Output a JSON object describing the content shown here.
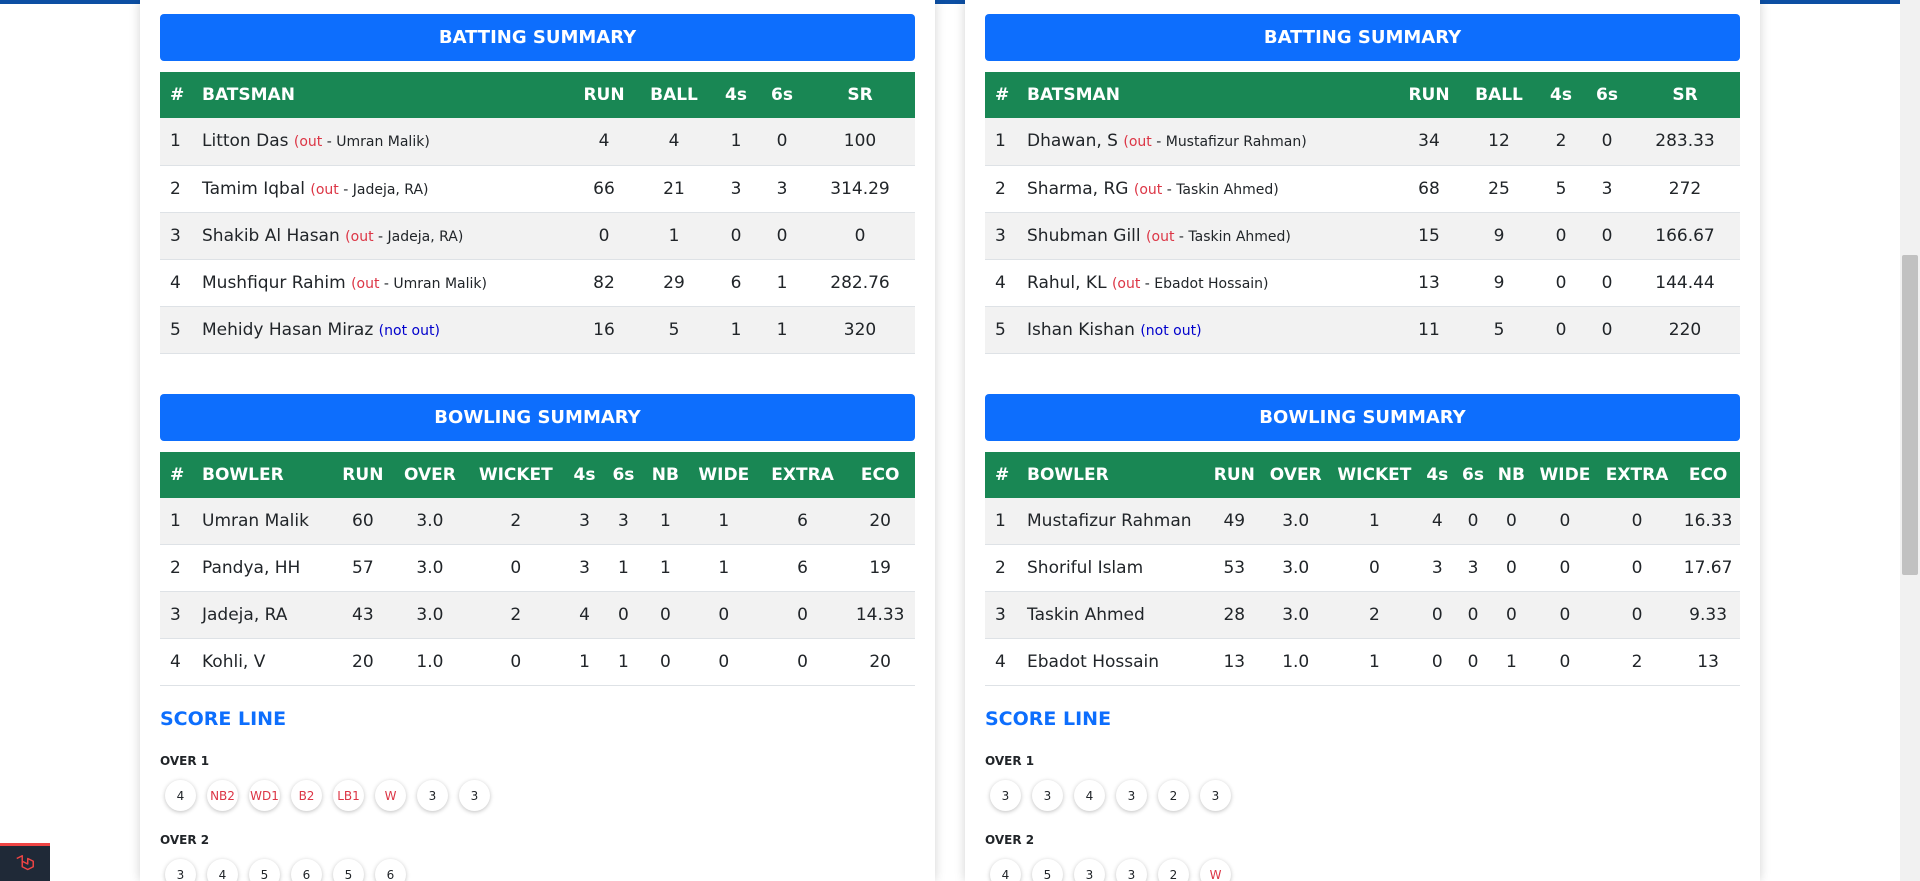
{
  "left": {
    "batting": {
      "title": "BATTING SUMMARY",
      "headers": [
        "#",
        "BATSMAN",
        "RUN",
        "BALL",
        "4s",
        "6s",
        "SR"
      ],
      "rows": [
        {
          "idx": "1",
          "name": "Litton Das",
          "status_prefix": "(out",
          "status_by": " - Umran Malik)",
          "status_close": "",
          "run": "4",
          "ball": "4",
          "fours": "1",
          "sixes": "0",
          "sr": "100"
        },
        {
          "idx": "2",
          "name": "Tamim Iqbal",
          "status_prefix": "(out",
          "status_by": " - Jadeja, RA)",
          "status_close": "",
          "run": "66",
          "ball": "21",
          "fours": "3",
          "sixes": "3",
          "sr": "314.29"
        },
        {
          "idx": "3",
          "name": "Shakib Al Hasan",
          "status_prefix": "(out",
          "status_by": " - Jadeja, RA)",
          "status_close": "",
          "run": "0",
          "ball": "1",
          "fours": "0",
          "sixes": "0",
          "sr": "0"
        },
        {
          "idx": "4",
          "name": "Mushfiqur Rahim",
          "status_prefix": "(out",
          "status_by": " - Umran Malik)",
          "status_close": "",
          "run": "82",
          "ball": "29",
          "fours": "6",
          "sixes": "1",
          "sr": "282.76"
        },
        {
          "idx": "5",
          "name": "Mehidy Hasan Miraz",
          "notout": "(not out)",
          "run": "16",
          "ball": "5",
          "fours": "1",
          "sixes": "1",
          "sr": "320"
        }
      ]
    },
    "bowling": {
      "title": "BOWLING SUMMARY",
      "headers": [
        "#",
        "BOWLER",
        "RUN",
        "OVER",
        "WICKET",
        "4s",
        "6s",
        "NB",
        "WIDE",
        "EXTRA",
        "ECO"
      ],
      "rows": [
        {
          "idx": "1",
          "name": "Umran Malik",
          "run": "60",
          "over": "3.0",
          "wicket": "2",
          "fours": "3",
          "sixes": "3",
          "nb": "1",
          "wide": "1",
          "extra": "6",
          "eco": "20"
        },
        {
          "idx": "2",
          "name": "Pandya, HH",
          "run": "57",
          "over": "3.0",
          "wicket": "0",
          "fours": "3",
          "sixes": "1",
          "nb": "1",
          "wide": "1",
          "extra": "6",
          "eco": "19"
        },
        {
          "idx": "3",
          "name": "Jadeja, RA",
          "run": "43",
          "over": "3.0",
          "wicket": "2",
          "fours": "4",
          "sixes": "0",
          "nb": "0",
          "wide": "0",
          "extra": "0",
          "eco": "14.33"
        },
        {
          "idx": "4",
          "name": "Kohli, V",
          "run": "20",
          "over": "1.0",
          "wicket": "0",
          "fours": "1",
          "sixes": "1",
          "nb": "0",
          "wide": "0",
          "extra": "0",
          "eco": "20"
        }
      ]
    },
    "scoreline": {
      "title": "SCORE LINE",
      "overs": [
        {
          "label": "OVER 1",
          "balls": [
            {
              "v": "4",
              "red": false
            },
            {
              "v": "NB2",
              "red": true
            },
            {
              "v": "WD1",
              "red": true
            },
            {
              "v": "B2",
              "red": true
            },
            {
              "v": "LB1",
              "red": true
            },
            {
              "v": "W",
              "red": true
            },
            {
              "v": "3",
              "red": false
            },
            {
              "v": "3",
              "red": false
            }
          ]
        },
        {
          "label": "OVER 2",
          "balls": [
            {
              "v": "3",
              "red": false
            },
            {
              "v": "4",
              "red": false
            },
            {
              "v": "5",
              "red": false
            },
            {
              "v": "6",
              "red": false
            },
            {
              "v": "5",
              "red": false
            },
            {
              "v": "6",
              "red": false
            }
          ]
        }
      ]
    }
  },
  "right": {
    "batting": {
      "title": "BATTING SUMMARY",
      "headers": [
        "#",
        "BATSMAN",
        "RUN",
        "BALL",
        "4s",
        "6s",
        "SR"
      ],
      "rows": [
        {
          "idx": "1",
          "name": "Dhawan, S",
          "status_prefix": "(out",
          "status_by": " - Mustafizur Rahman)",
          "run": "34",
          "ball": "12",
          "fours": "2",
          "sixes": "0",
          "sr": "283.33"
        },
        {
          "idx": "2",
          "name": "Sharma, RG",
          "status_prefix": "(out",
          "status_by": " - Taskin Ahmed)",
          "run": "68",
          "ball": "25",
          "fours": "5",
          "sixes": "3",
          "sr": "272"
        },
        {
          "idx": "3",
          "name": "Shubman Gill",
          "status_prefix": "(out",
          "status_by": " - Taskin Ahmed)",
          "run": "15",
          "ball": "9",
          "fours": "0",
          "sixes": "0",
          "sr": "166.67"
        },
        {
          "idx": "4",
          "name": "Rahul, KL",
          "status_prefix": "(out",
          "status_by": " - Ebadot Hossain)",
          "run": "13",
          "ball": "9",
          "fours": "0",
          "sixes": "0",
          "sr": "144.44"
        },
        {
          "idx": "5",
          "name": "Ishan Kishan",
          "notout": "(not out)",
          "run": "11",
          "ball": "5",
          "fours": "0",
          "sixes": "0",
          "sr": "220"
        }
      ]
    },
    "bowling": {
      "title": "BOWLING SUMMARY",
      "headers": [
        "#",
        "BOWLER",
        "RUN",
        "OVER",
        "WICKET",
        "4s",
        "6s",
        "NB",
        "WIDE",
        "EXTRA",
        "ECO"
      ],
      "rows": [
        {
          "idx": "1",
          "name": "Mustafizur Rahman",
          "run": "49",
          "over": "3.0",
          "wicket": "1",
          "fours": "4",
          "sixes": "0",
          "nb": "0",
          "wide": "0",
          "extra": "0",
          "eco": "16.33"
        },
        {
          "idx": "2",
          "name": "Shoriful Islam",
          "run": "53",
          "over": "3.0",
          "wicket": "0",
          "fours": "3",
          "sixes": "3",
          "nb": "0",
          "wide": "0",
          "extra": "0",
          "eco": "17.67"
        },
        {
          "idx": "3",
          "name": "Taskin Ahmed",
          "run": "28",
          "over": "3.0",
          "wicket": "2",
          "fours": "0",
          "sixes": "0",
          "nb": "0",
          "wide": "0",
          "extra": "0",
          "eco": "9.33"
        },
        {
          "idx": "4",
          "name": "Ebadot Hossain",
          "run": "13",
          "over": "1.0",
          "wicket": "1",
          "fours": "0",
          "sixes": "0",
          "nb": "1",
          "wide": "0",
          "extra": "2",
          "eco": "13"
        }
      ]
    },
    "scoreline": {
      "title": "SCORE LINE",
      "overs": [
        {
          "label": "OVER 1",
          "balls": [
            {
              "v": "3",
              "red": false
            },
            {
              "v": "3",
              "red": false
            },
            {
              "v": "4",
              "red": false
            },
            {
              "v": "3",
              "red": false
            },
            {
              "v": "2",
              "red": false
            },
            {
              "v": "3",
              "red": false
            }
          ]
        },
        {
          "label": "OVER 2",
          "balls": [
            {
              "v": "4",
              "red": false
            },
            {
              "v": "5",
              "red": false
            },
            {
              "v": "3",
              "red": false
            },
            {
              "v": "3",
              "red": false
            },
            {
              "v": "2",
              "red": false
            },
            {
              "v": "W",
              "red": true
            }
          ]
        }
      ]
    }
  },
  "colors": {
    "header_blue": "#0d6efd",
    "table_green": "#198754",
    "out_red": "#dc3545",
    "notout_blue": "#0000cc",
    "topbar": "#0d4fa3"
  },
  "icons": {
    "corner_badge": "laravel-logo-icon"
  }
}
